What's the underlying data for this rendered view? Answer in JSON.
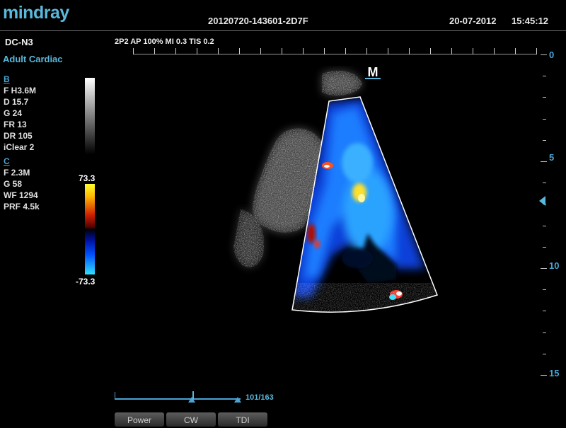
{
  "header": {
    "brand": "mindray",
    "exam_id": "20120720-143601-2D7F",
    "date": "20-07-2012",
    "time": "15:45:12"
  },
  "probe": "DC-N3",
  "preset": "Adult Cardiac",
  "acoustic": "2P2  AP 100%  MI 0.3  TIS 0.2",
  "b_mode": {
    "section": "B",
    "params": [
      "F H3.6M",
      "D 15.7",
      "G 24",
      "FR 13",
      "DR 105",
      "iClear 2"
    ]
  },
  "color_mode": {
    "section": "C",
    "params": [
      "F 2.3M",
      "G 58",
      "WF 1294",
      "PRF 4.5k"
    ]
  },
  "color_scale": {
    "max": "73.3",
    "min": "-73.3"
  },
  "depth_labels": [
    "0",
    "5",
    "10",
    "15"
  ],
  "orientation_marker": "M",
  "cine": {
    "counter": "101/163",
    "position_fraction": 0.62
  },
  "softkeys": [
    "Power",
    "CW",
    "TDI"
  ],
  "colors": {
    "accent": "#5ab8dc",
    "ruler": "#4aa4d4"
  }
}
